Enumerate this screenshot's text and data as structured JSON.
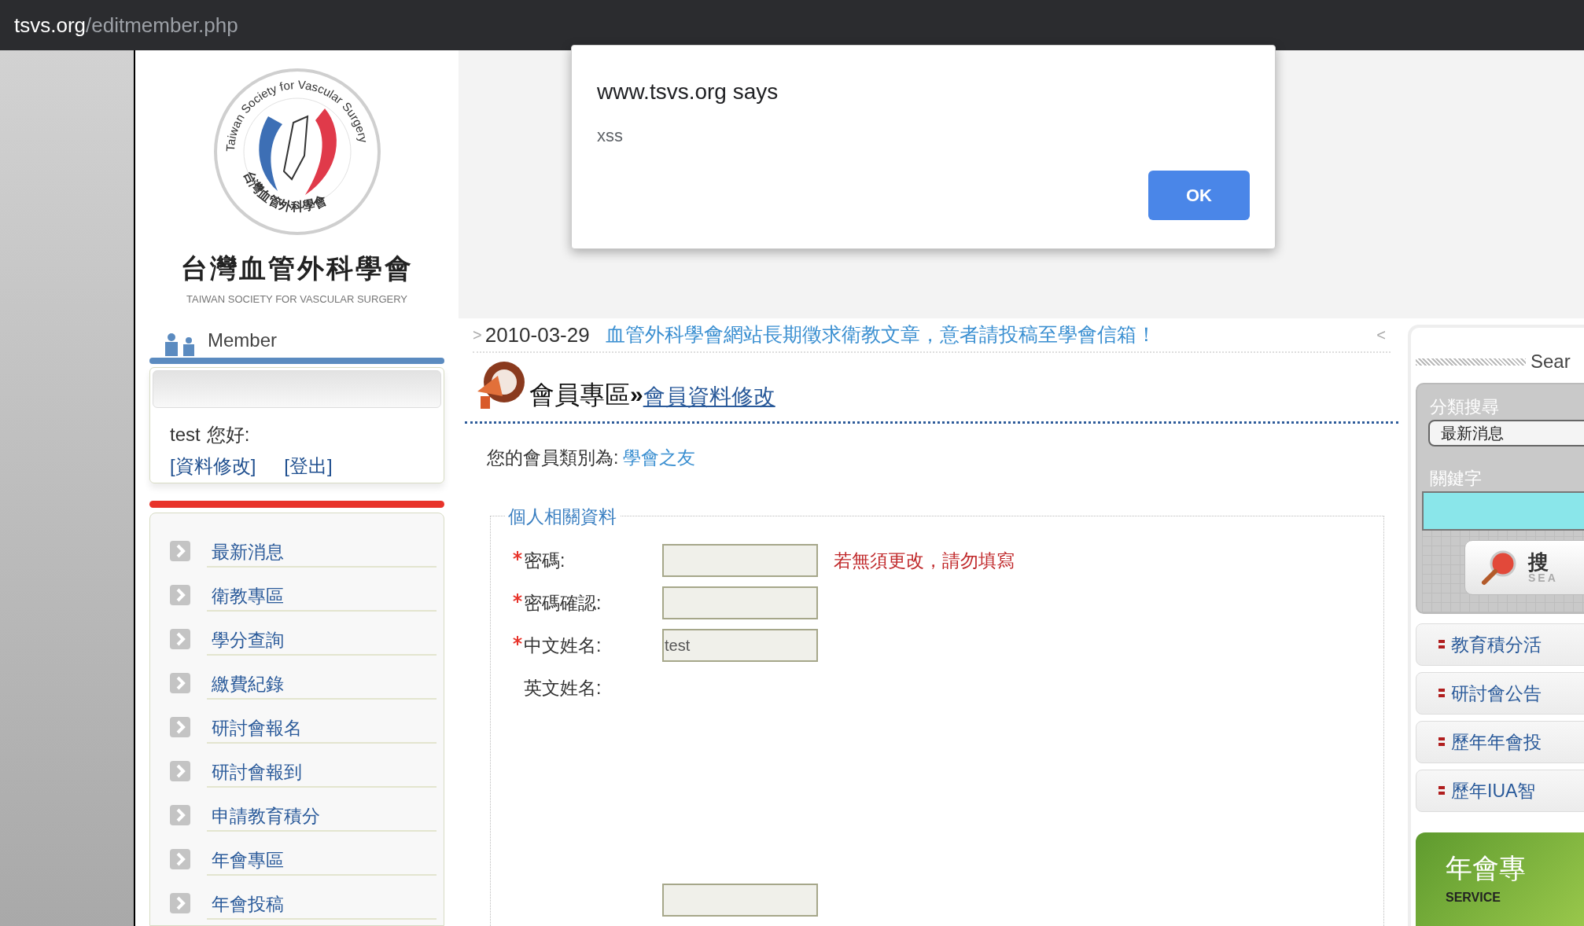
{
  "browser": {
    "url_host": "tsvs.org",
    "url_path": "/editmember.php"
  },
  "dialog": {
    "title": "www.tsvs.org says",
    "message": "xss",
    "button": "OK"
  },
  "logo": {
    "ring_top": "Taiwan Society for Vascular Surgery",
    "ring_bottom": "台灣血管外科學會",
    "name": "台灣血管外科學會",
    "name_en": "TAIWAN SOCIETY FOR VASCULAR SURGERY"
  },
  "member": {
    "heading": "Member",
    "user": "test",
    "greeting": "您好:",
    "links": [
      "[資料修改]",
      "[登出]"
    ]
  },
  "menu": [
    "最新消息",
    "衛教專區",
    "學分查詢",
    "繳費紀錄",
    "研討會報名",
    "研討會報到",
    "申請教育積分",
    "年會專區",
    "年會投稿"
  ],
  "news": {
    "prev": ">",
    "date": "2010-03-29",
    "text": "血管外科學會網站長期徵求衛教文章，意者請投稿至學會信箱！",
    "next": "<"
  },
  "page": {
    "section": "會員專區",
    "separator": "»",
    "title": "會員資料修改"
  },
  "member_type": {
    "label": "您的會員類別為:",
    "value": "學會之友"
  },
  "form": {
    "legend": "個人相關資料",
    "fields": [
      {
        "kind": "input",
        "required": true,
        "label": "密碼:",
        "hint": "若無須更改，請勿填寫"
      },
      {
        "kind": "input",
        "required": true,
        "label": "密碼確認:"
      },
      {
        "kind": "input",
        "required": true,
        "label": "中文姓名:",
        "value": "test"
      },
      {
        "kind": "label",
        "required": false,
        "label": "英文姓名:"
      },
      {
        "kind": "input",
        "required": false
      }
    ]
  },
  "search": {
    "heading": "Sear",
    "category_label": "分類搜尋",
    "category_value": "最新消息",
    "keyword_label": "關鍵字",
    "button": "搜",
    "button_en": "SEA"
  },
  "side_links": [
    "教育積分活",
    "研討會公告",
    "歷年年會投",
    "歷年IUA智"
  ],
  "banner": {
    "title": "年會專",
    "subtitle": "SERVICE"
  }
}
